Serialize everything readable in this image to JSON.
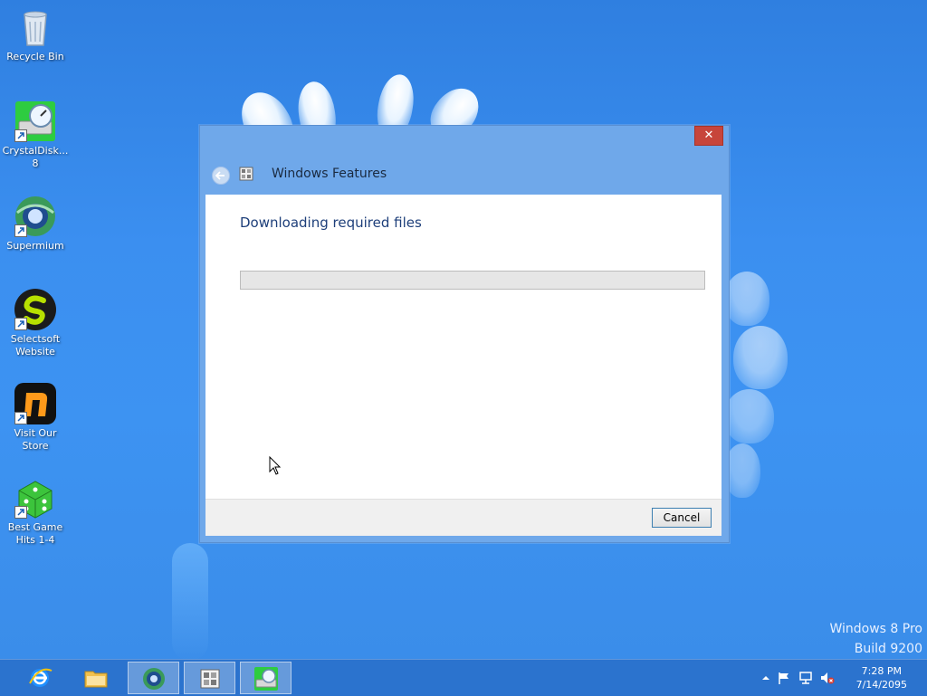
{
  "desktop": {
    "icons": [
      {
        "label": "Recycle Bin",
        "icon": "recycle-bin-icon"
      },
      {
        "label": "CrystalDisk... 8",
        "icon": "crystaldisk-icon"
      },
      {
        "label": "Supermium",
        "icon": "supermium-icon"
      },
      {
        "label": "Selectsoft Website",
        "icon": "selectsoft-icon"
      },
      {
        "label": "Visit Our Store",
        "icon": "store-icon"
      },
      {
        "label": "Best Game Hits 1-4",
        "icon": "dice-icon"
      }
    ]
  },
  "dialog": {
    "title": "Windows Features",
    "heading": "Downloading required files",
    "progress": 0,
    "close_label": "✕",
    "cancel_label": "Cancel"
  },
  "watermark": {
    "line1": "Windows 8 Pro",
    "line2": "Build 9200"
  },
  "taskbar": {
    "items": [
      {
        "name": "internet-explorer",
        "active": false
      },
      {
        "name": "file-explorer",
        "active": false
      },
      {
        "name": "supermium",
        "active": true
      },
      {
        "name": "windows-features",
        "active": true
      },
      {
        "name": "crystaldisk",
        "active": true
      }
    ],
    "clock": {
      "time": "7:28 PM",
      "date": "7/14/2095"
    }
  },
  "colors": {
    "accent": "#6fa8ea",
    "close": "#c7453b",
    "heading": "#1e3f7a"
  }
}
